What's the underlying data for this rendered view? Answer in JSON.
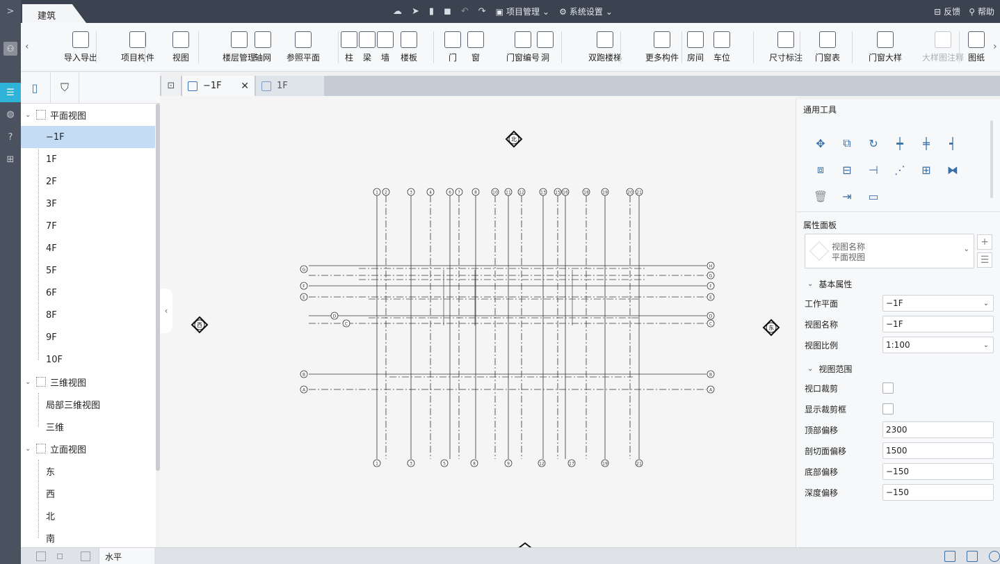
{
  "app": {
    "tab_label": "建筑",
    "top_menu": {
      "project_mgmt": "项目管理",
      "system_settings": "系统设置"
    },
    "top_right": {
      "feedback": "反馈",
      "help": "帮助"
    }
  },
  "ribbon": {
    "buttons": [
      {
        "id": "import-export",
        "label": "导入导出",
        "icon": "cad-icon"
      },
      {
        "id": "project-component",
        "label": "项目构件",
        "icon": "component-icon"
      },
      {
        "id": "view",
        "label": "视图",
        "icon": "view-icon"
      },
      {
        "id": "floor-mgmt",
        "label": "楼层管理",
        "icon": "floor-icon"
      },
      {
        "id": "axis-grid",
        "label": "轴网",
        "icon": "axis-icon"
      },
      {
        "id": "ref-plane",
        "label": "参照平面",
        "icon": "ref-plane-icon"
      },
      {
        "id": "column",
        "label": "柱",
        "icon": "column-icon"
      },
      {
        "id": "beam",
        "label": "梁",
        "icon": "beam-icon"
      },
      {
        "id": "wall",
        "label": "墙",
        "icon": "wall-icon"
      },
      {
        "id": "slab",
        "label": "楼板",
        "icon": "slab-icon"
      },
      {
        "id": "door",
        "label": "门",
        "icon": "door-icon"
      },
      {
        "id": "window",
        "label": "窗",
        "icon": "window-icon"
      },
      {
        "id": "door-window-number",
        "label": "门窗编号",
        "icon": "number-icon"
      },
      {
        "id": "hole",
        "label": "洞",
        "icon": "hole-icon"
      },
      {
        "id": "double-stair",
        "label": "双跑楼梯",
        "icon": "stair-icon"
      },
      {
        "id": "more-components",
        "label": "更多构件",
        "icon": "more-icon"
      },
      {
        "id": "room",
        "label": "房间",
        "icon": "room-icon"
      },
      {
        "id": "parking",
        "label": "车位",
        "icon": "parking-icon"
      },
      {
        "id": "dimension",
        "label": "尺寸标注",
        "icon": "dimension-icon"
      },
      {
        "id": "door-window-table",
        "label": "门窗表",
        "icon": "table-icon"
      },
      {
        "id": "door-window-detail",
        "label": "门窗大样",
        "icon": "detail-icon"
      },
      {
        "id": "detail-annotation",
        "label": "大样图注释",
        "icon": "annotation-icon",
        "disabled": true
      },
      {
        "id": "drawing",
        "label": "图纸",
        "icon": "drawing-icon"
      }
    ]
  },
  "tree": {
    "groups": [
      {
        "label": "平面视图",
        "items": [
          "−1F",
          "1F",
          "2F",
          "3F",
          "7F",
          "4F",
          "5F",
          "6F",
          "8F",
          "9F",
          "10F"
        ]
      },
      {
        "label": "三维视图",
        "items": [
          "局部三维视图",
          "三维"
        ]
      },
      {
        "label": "立面视图",
        "items": [
          "东",
          "西",
          "北",
          "南"
        ]
      }
    ],
    "selected": "−1F"
  },
  "doc_tabs": {
    "active": "−1F",
    "inactive": "1F"
  },
  "drawing": {
    "elevation_markers": {
      "north": "北",
      "west": "西",
      "east": "东"
    },
    "top_bubbles": [
      "1",
      "2",
      "3",
      "4",
      "6",
      "7",
      "8",
      "10",
      "11",
      "12",
      "13",
      "15",
      "16",
      "18",
      "19",
      "20",
      "21"
    ],
    "bottom_bubbles": [
      "1",
      "3",
      "5",
      "8",
      "9",
      "12",
      "17",
      "19",
      "21"
    ],
    "right_bubbles": [
      "H",
      "G",
      "F",
      "E",
      "D",
      "C",
      "B",
      "A"
    ],
    "left_bubbles": [
      "G",
      "F",
      "E",
      "D",
      "C",
      "B",
      "A"
    ]
  },
  "right_panel": {
    "tools_title": "通用工具",
    "props_title": "属性面板",
    "view_selector": {
      "line1": "视图名称",
      "line2": "平面视图"
    },
    "basic_group": "基本属性",
    "basic": [
      {
        "label": "工作平面",
        "value": "−1F",
        "dropdown": true
      },
      {
        "label": "视图名称",
        "value": "−1F",
        "dropdown": false
      },
      {
        "label": "视图比例",
        "value": "1:100",
        "dropdown": true
      }
    ],
    "range_group": "视图范围",
    "range_checks": [
      {
        "label": "视口裁剪"
      },
      {
        "label": "显示裁剪框"
      }
    ],
    "range": [
      {
        "label": "顶部偏移",
        "value": "2300"
      },
      {
        "label": "剖切面偏移",
        "value": "1500"
      },
      {
        "label": "底部偏移",
        "value": "−150"
      },
      {
        "label": "深度偏移",
        "value": "−150"
      }
    ]
  },
  "status": {
    "mode": "水平"
  },
  "colors": {
    "accent": "#2fb3d8",
    "topbar": "#3b4250",
    "rail": "#4a5260",
    "selection": "#c5dcf5"
  }
}
